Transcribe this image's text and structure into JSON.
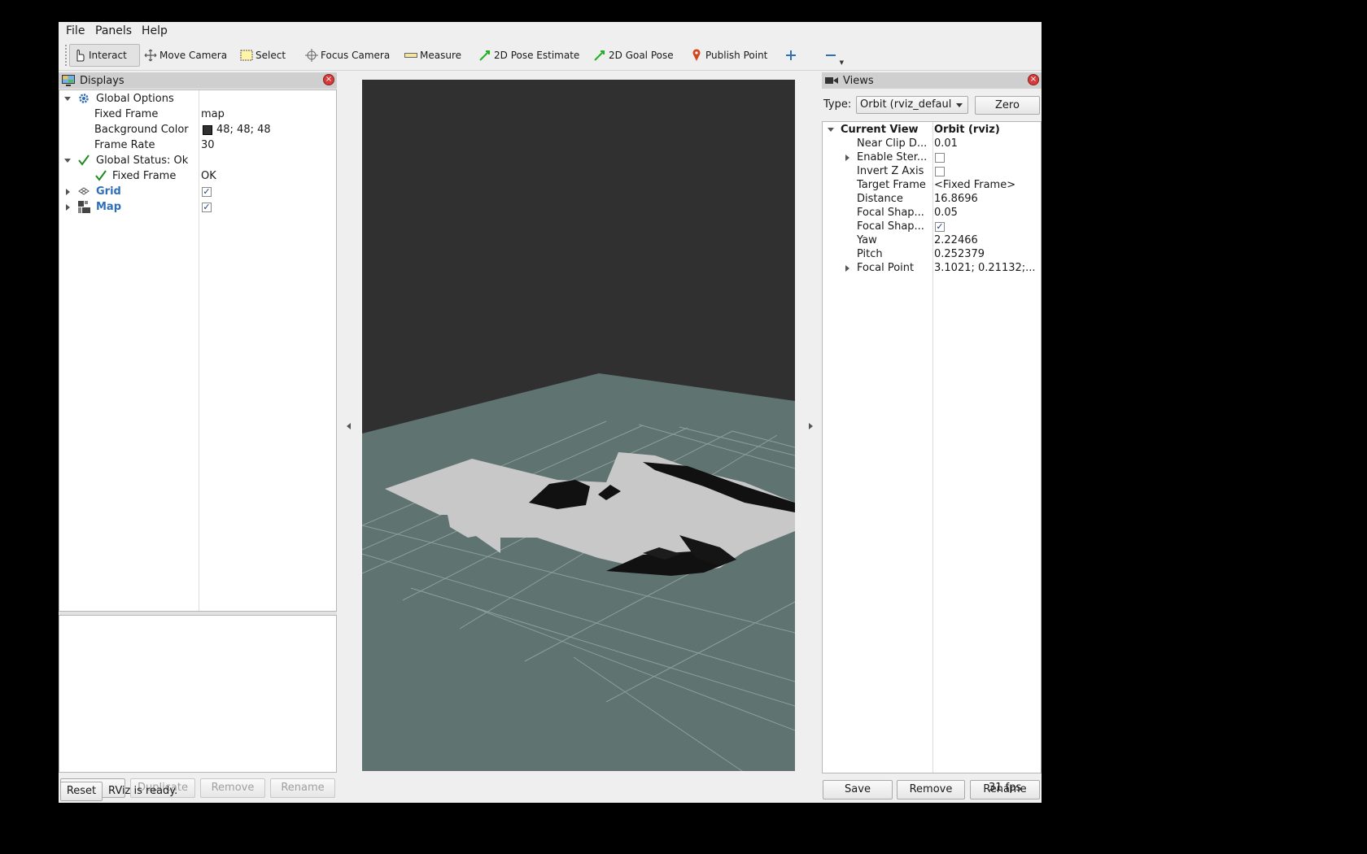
{
  "menu": {
    "file": "File",
    "panels": "Panels",
    "help": "Help"
  },
  "toolbar": {
    "interact": "Interact",
    "move_camera": "Move Camera",
    "select": "Select",
    "focus_camera": "Focus Camera",
    "measure": "Measure",
    "pose_estimate": "2D Pose Estimate",
    "goal_pose": "2D Goal Pose",
    "publish_point": "Publish Point"
  },
  "displays": {
    "title": "Displays",
    "rows": {
      "global_options": "Global Options",
      "fixed_frame_label": "Fixed Frame",
      "fixed_frame_value": "map",
      "bg_color_label": "Background Color",
      "bg_color_value": "48; 48; 48",
      "frame_rate_label": "Frame Rate",
      "frame_rate_value": "30",
      "global_status": "Global Status: Ok",
      "status_fixed_frame_label": "Fixed Frame",
      "status_fixed_frame_value": "OK",
      "grid": "Grid",
      "map": "Map"
    },
    "buttons": {
      "add": "Add",
      "duplicate": "Duplicate",
      "remove": "Remove",
      "rename": "Rename"
    }
  },
  "status": {
    "reset": "Reset",
    "message": "RViz is ready.",
    "fps": "31 fps"
  },
  "views": {
    "title": "Views",
    "type_label": "Type:",
    "type_value": "Orbit (rviz_defaul",
    "zero": "Zero",
    "current_view_label": "Current View",
    "current_view_value": "Orbit (rviz)",
    "props": [
      {
        "label": "Near Clip D...",
        "value": "0.01"
      },
      {
        "label": "Enable Ster...",
        "value": ""
      },
      {
        "label": "Invert Z Axis",
        "value": ""
      },
      {
        "label": "Target Frame",
        "value": "<Fixed Frame>"
      },
      {
        "label": "Distance",
        "value": "16.8696"
      },
      {
        "label": "Focal Shap...",
        "value": "0.05"
      },
      {
        "label": "Focal Shap...",
        "value": ""
      },
      {
        "label": "Yaw",
        "value": "2.22466"
      },
      {
        "label": "Pitch",
        "value": "0.252379"
      },
      {
        "label": "Focal Point",
        "value": "3.1021; 0.21132;..."
      }
    ],
    "buttons": {
      "save": "Save",
      "remove": "Remove",
      "rename": "Rename"
    }
  },
  "colors": {
    "background": "#303030",
    "ground": "#5f7370",
    "map_free": "#c8c8c8",
    "accent_blue": "#2f6fb8"
  }
}
